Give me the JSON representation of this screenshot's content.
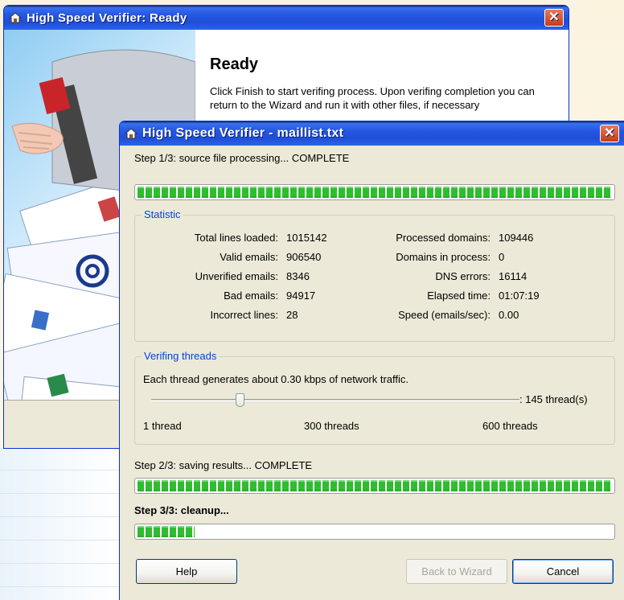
{
  "back_window": {
    "title": "High Speed Verifier: Ready",
    "heading": "Ready",
    "body_text": "Click Finish to start verifing process. Upon verifing completion you can return to the Wizard and run it with other files, if necessary"
  },
  "front_window": {
    "title": "High Speed Verifier - maillist.txt",
    "step1": {
      "label": "Step 1/3: source file processing... COMPLETE",
      "progress": 1.0
    },
    "statistic": {
      "title": "Statistic",
      "left": [
        {
          "label": "Total lines loaded:",
          "value": "1015142"
        },
        {
          "label": "Valid emails:",
          "value": "906540"
        },
        {
          "label": "Unverified emails:",
          "value": "8346"
        },
        {
          "label": "Bad emails:",
          "value": "94917"
        },
        {
          "label": "Incorrect lines:",
          "value": "28"
        }
      ],
      "right": [
        {
          "label": "Processed domains:",
          "value": "109446"
        },
        {
          "label": "Domains in process:",
          "value": "0"
        },
        {
          "label": "DNS errors:",
          "value": "16114"
        },
        {
          "label": "Elapsed time:",
          "value": "01:07:19"
        },
        {
          "label": "Speed (emails/sec):",
          "value": "0.00"
        }
      ]
    },
    "threads": {
      "title": "Verifing threads",
      "description": "Each thread generates about 0.30 kbps of network traffic.",
      "value_text": ": 145 thread(s)",
      "value": 145,
      "min": 1,
      "max": 600,
      "min_label": "1 thread",
      "mid_label": "300 threads",
      "max_label": "600 threads"
    },
    "step2": {
      "label": "Step 2/3: saving results... COMPLETE",
      "progress": 1.0
    },
    "step3": {
      "label": "Step 3/3: cleanup...",
      "progress": 0.12
    },
    "buttons": {
      "help": "Help",
      "back": "Back to Wizard",
      "cancel": "Cancel"
    }
  },
  "colors": {
    "titlebar": "#2456e0",
    "progress_green": "#2fbd2f",
    "group_title": "#0046d5",
    "close_button": "#c63b16"
  }
}
